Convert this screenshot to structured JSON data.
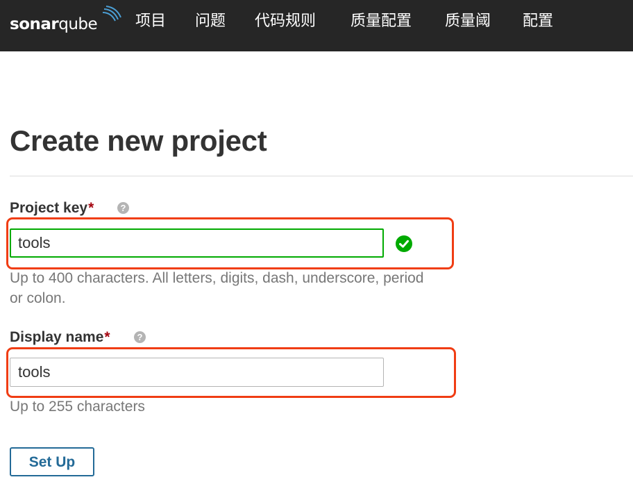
{
  "app": {
    "logo_bold": "sonar",
    "logo_thin": "qube"
  },
  "nav": {
    "items": [
      "项目",
      "问题",
      "代码规则",
      "质量配置",
      "质量阈",
      "配置"
    ]
  },
  "page": {
    "title": "Create new project"
  },
  "form": {
    "project_key": {
      "label": "Project key",
      "required_mark": "*",
      "value": "tools",
      "status": "valid",
      "hint_line1": "Up to 400 characters. All letters, digits, dash, underscore, period",
      "hint_line2": "or colon."
    },
    "display_name": {
      "label": "Display name",
      "required_mark": "*",
      "value": "tools",
      "hint": "Up to 255 characters"
    },
    "submit_label": "Set Up"
  },
  "icons": {
    "help": "question-circle-icon",
    "valid": "check-circle-icon",
    "logo_waves": "sonar-waves-icon"
  },
  "colors": {
    "navbar": "#262626",
    "valid": "#00aa00",
    "required": "#a4030f",
    "button": "#236a97",
    "annotation": "#f03d14"
  }
}
